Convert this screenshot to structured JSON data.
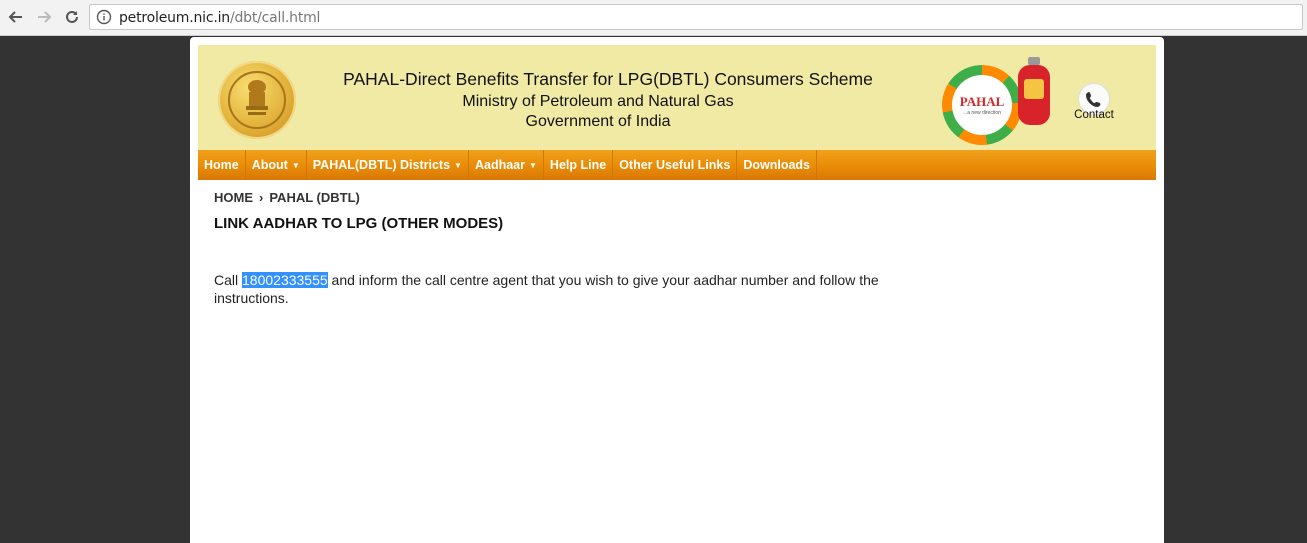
{
  "browser": {
    "url_host": "petroleum.nic.in",
    "url_path": "/dbt/call.html"
  },
  "header": {
    "title": "PAHAL-Direct Benefits Transfer for LPG(DBTL) Consumers Scheme",
    "subtitle": "Ministry of Petroleum and Natural Gas",
    "subtitle2": "Government of India",
    "logo_text": "PAHAL",
    "logo_tagline": "...a new direction",
    "contact_label": "Contact"
  },
  "menu": {
    "items": [
      {
        "label": "Home"
      },
      {
        "label": "About"
      },
      {
        "label": "PAHAL(DBTL) Districts"
      },
      {
        "label": "Aadhaar"
      },
      {
        "label": "Help Line"
      },
      {
        "label": "Other Useful Links"
      },
      {
        "label": "Downloads"
      }
    ]
  },
  "breadcrumb": {
    "home": "HOME",
    "separator": "›",
    "current": "PAHAL (DBTL)"
  },
  "content": {
    "title": "LINK AADHAR TO LPG (OTHER MODES)",
    "text_before": "Call ",
    "phone": "18002333555",
    "text_after": " and inform the call centre agent that you wish to give your aadhar number and follow the instructions."
  },
  "colors": {
    "header_bg": "#f0eaa5",
    "menu_bg": "#e98b06",
    "selection": "#3390ff"
  }
}
